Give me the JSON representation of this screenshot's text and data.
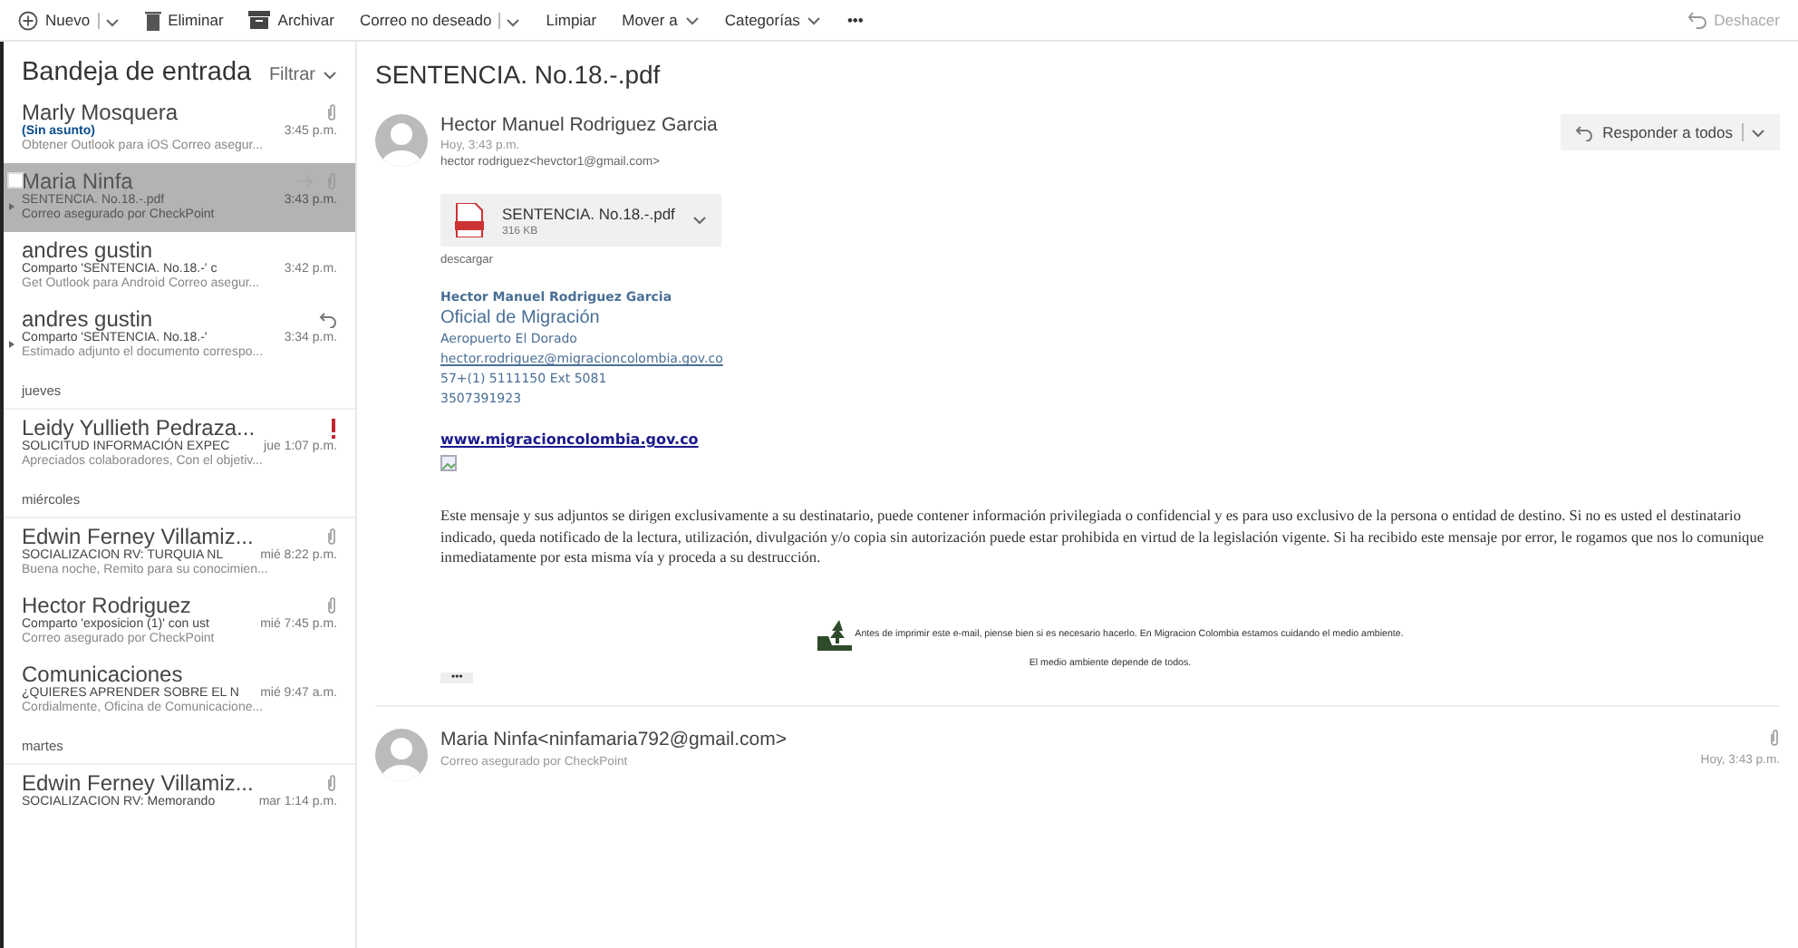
{
  "toolbar": {
    "left": [
      {
        "label": "Nuevo",
        "kind": "split",
        "disabled": false
      },
      {
        "label": "Eliminar",
        "kind": "button",
        "disabled": false
      },
      {
        "label": "Archivar",
        "kind": "button",
        "disabled": false
      },
      {
        "label": "Correo no deseado",
        "kind": "split",
        "disabled": false
      },
      {
        "label": "Limpiar",
        "kind": "button",
        "disabled": false
      },
      {
        "label": "Mover a",
        "kind": "menu",
        "disabled": false
      },
      {
        "label": "Categorías",
        "kind": "menu",
        "disabled": false
      },
      {
        "label": "•••",
        "kind": "more",
        "disabled": false
      }
    ],
    "right": [
      {
        "label": "Deshacer",
        "kind": "button",
        "disabled": true
      }
    ]
  },
  "message_list": {
    "title": "Bandeja de entrada",
    "filter": "Filtrar",
    "entries": [
      {
        "kind": "message",
        "sender": "Marly Mosquera",
        "subject": "(Sin asunto)",
        "time": "3:45 p.m.",
        "preview": "Obtener Outlook para iOS Correo asegur...",
        "has_attachment": true,
        "flagged": false,
        "replied": false,
        "thread": false,
        "unread": true,
        "selected": false
      },
      {
        "kind": "message",
        "sender": "Maria Ninfa",
        "subject": "SENTENCIA. No.18.-.pdf",
        "time": "3:43 p.m.",
        "preview": "Correo asegurado por CheckPoint",
        "has_attachment": true,
        "flagged": false,
        "replied": false,
        "thread": true,
        "unread": false,
        "selected": true
      },
      {
        "kind": "message",
        "sender": "andres gustin",
        "subject": "Comparto 'SENTENCIA. No.18.-' c",
        "time": "3:42 p.m.",
        "preview": "Get Outlook para Android Correo asegur...",
        "has_attachment": false,
        "flagged": false,
        "replied": false,
        "thread": false,
        "unread": false,
        "selected": false
      },
      {
        "kind": "message",
        "sender": "andres gustin",
        "subject": "Comparto 'SENTENCIA. No.18.-'",
        "time": "3:34 p.m.",
        "preview": "Estimado adjunto el documento correspo...",
        "has_attachment": false,
        "flagged": false,
        "replied": true,
        "thread": true,
        "unread": false,
        "selected": false
      },
      {
        "kind": "group",
        "label": "jueves"
      },
      {
        "kind": "message",
        "sender": "Leidy Yullieth Pedraza...",
        "subject": "SOLICITUD INFORMACIÓN EXPEC",
        "time": "jue 1:07 p.m.",
        "preview": "Apreciados colaboradores, Con el objetiv...",
        "has_attachment": false,
        "flagged": true,
        "replied": false,
        "thread": false,
        "unread": false,
        "selected": false
      },
      {
        "kind": "group",
        "label": "miércoles"
      },
      {
        "kind": "message",
        "sender": "Edwin Ferney Villamiz...",
        "subject": "SOCIALIZACION RV: TURQUIA NL",
        "time": "mié 8:22 p.m.",
        "preview": "Buena noche, Remito para su conocimien...",
        "has_attachment": true,
        "flagged": false,
        "replied": false,
        "thread": false,
        "unread": false,
        "selected": false
      },
      {
        "kind": "message",
        "sender": "Hector Rodriguez",
        "subject": "Comparto 'exposicion (1)' con ust",
        "time": "mié 7:45 p.m.",
        "preview": "Correo asegurado por CheckPoint",
        "has_attachment": true,
        "flagged": false,
        "replied": false,
        "thread": false,
        "unread": false,
        "selected": false
      },
      {
        "kind": "message",
        "sender": "Comunicaciones",
        "subject": "¿QUIERES APRENDER SOBRE EL N",
        "time": "mié 9:47 a.m.",
        "preview": "Cordialmente, Oficina de Comunicacione...",
        "has_attachment": false,
        "flagged": false,
        "replied": false,
        "thread": false,
        "unread": false,
        "selected": false
      },
      {
        "kind": "group",
        "label": "martes"
      },
      {
        "kind": "message",
        "sender": "Edwin Ferney Villamiz...",
        "subject": "SOCIALIZACION RV: Memorando",
        "time": "mar 1:14 p.m.",
        "has_attachment": true,
        "flagged": false,
        "replied": false,
        "thread": false,
        "unread": false,
        "selected": false
      }
    ]
  },
  "reading_pane": {
    "subject": "SENTENCIA. No.18.-.pdf",
    "messages": [
      {
        "expanded": true,
        "sender": "Hector Manuel Rodriguez Garcia",
        "time": "Hoy, 3:43 p.m.",
        "to": "hector rodriguez<hevctor1@gmail.com>",
        "reply_all": "Responder a todos",
        "attachment": {
          "name": "SENTENCIA. No.18.-.pdf",
          "size": "316 KB"
        },
        "download": "descargar",
        "signature": [
          {
            "kind": "name",
            "text": "Hector Manuel Rodriguez Garcia"
          },
          {
            "kind": "title",
            "text": "Oficial de Migración"
          },
          {
            "kind": "text",
            "text": "Aeropuerto El Dorado"
          },
          {
            "kind": "email",
            "text": "hector.rodriguez@migracioncolombia.gov.co"
          },
          {
            "kind": "text",
            "text": "57+(1) 5111150 Ext 5081"
          },
          {
            "kind": "text",
            "text": "3507391923"
          }
        ],
        "website": "www.migracioncolombia.gov.co",
        "disclaimer": "Este mensaje y sus adjuntos se dirigen exclusivamente a su destinatario, puede contener información privilegiada o confidencial y es para uso exclusivo de la persona o entidad de destino. Si no es usted el destinatario indicado, queda notificado de la lectura, utilización, divulgación y/o copia sin autorización puede estar prohibida en virtud de la legislación vigente. Si ha recibido este mensaje por error, le rogamos que nos lo comunique inmediatamente por esta misma vía y proceda a su destrucción.",
        "eco_note": [
          "Antes de imprimir este e-mail, piense bien si es necesario hacerlo. En Migracion Colombia estamos cuidando el medio ambiente.",
          "El medio ambiente depende de todos."
        ],
        "more": "•••"
      },
      {
        "expanded": false,
        "sender": "Maria Ninfa<ninfamaria792@gmail.com>",
        "preview": "Correo asegurado por CheckPoint",
        "time": "Hoy, 3:43 p.m.",
        "has_attachment": true
      }
    ]
  }
}
